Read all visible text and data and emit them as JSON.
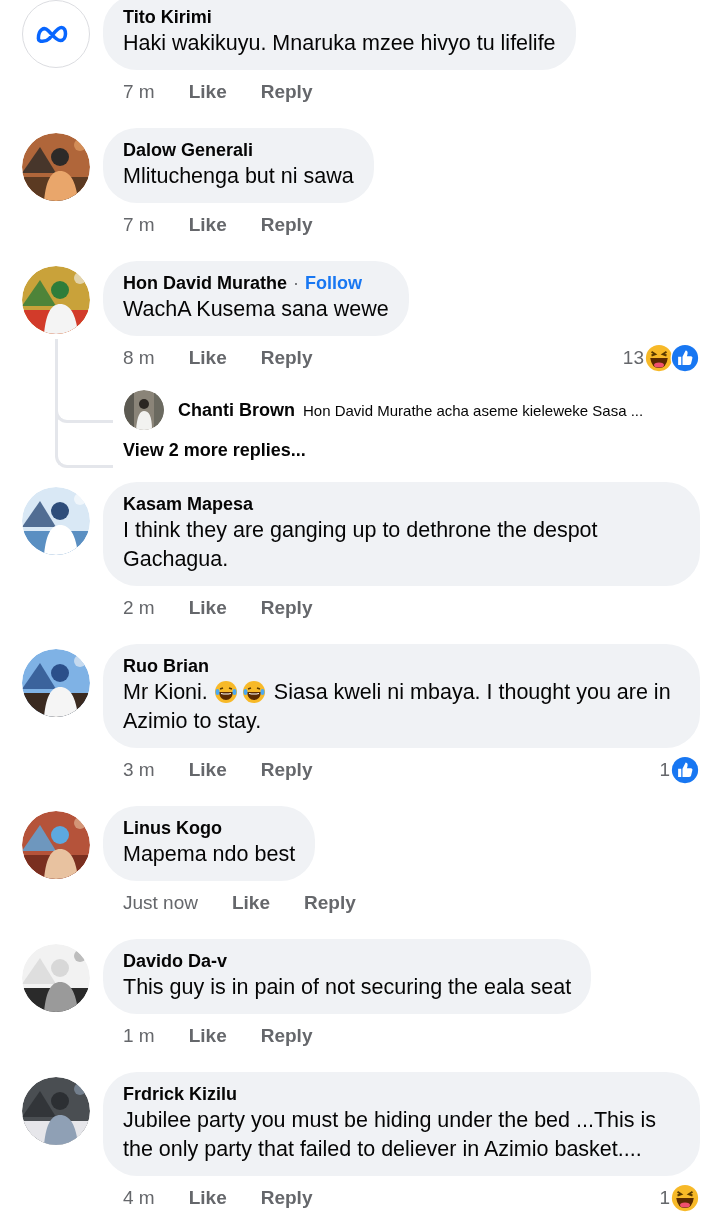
{
  "comments": [
    {
      "author": "Tito Kirimi",
      "avatar": {
        "kind": "logo"
      },
      "body": [
        {
          "kind": "text",
          "text": "Haki wakikuyu. Mnaruka mzee hivyo tu lifelife"
        }
      ],
      "time": "7 m",
      "like": "Like",
      "reply": "Reply"
    },
    {
      "author": "Dalow Generali",
      "avatar": {
        "kind": "picture"
      },
      "body": [
        {
          "kind": "text",
          "text": "Mlituchenga but ni sawa"
        }
      ],
      "time": "7 m",
      "like": "Like",
      "reply": "Reply"
    },
    {
      "author": "Hon David Murathe",
      "separator": "·",
      "follow": "Follow",
      "avatar": {
        "kind": "picture"
      },
      "body": [
        {
          "kind": "text",
          "text": "WachA Kusema sana wewe"
        }
      ],
      "time": "8 m",
      "like": "Like",
      "reply": "Reply",
      "reactions": {
        "count": "13",
        "types": [
          {
            "kind": "haha"
          },
          {
            "kind": "like"
          }
        ]
      },
      "replies": [
        {
          "author": "Chanti Brown",
          "text": "Hon David Murathe acha aseme kieleweke Sasa ..."
        }
      ],
      "more_replies": "View 2 more replies..."
    },
    {
      "author": "Kasam Mapesa",
      "avatar": {
        "kind": "picture"
      },
      "body": [
        {
          "kind": "text",
          "text": "I think they are ganging up to dethrone the despot Gachagua."
        }
      ],
      "time": "2 m",
      "like": "Like",
      "reply": "Reply"
    },
    {
      "author": "Ruo Brian",
      "avatar": {
        "kind": "picture"
      },
      "body": [
        {
          "kind": "text",
          "text": "Mr Kioni."
        },
        {
          "kind": "emoji"
        },
        {
          "kind": "emoji"
        },
        {
          "kind": "text",
          "text": "Siasa kweli ni mbaya. I thought you are in Azimio to stay."
        }
      ],
      "time": "3 m",
      "like": "Like",
      "reply": "Reply",
      "reactions": {
        "count": "1",
        "types": [
          {
            "kind": "like"
          }
        ]
      }
    },
    {
      "author": "Linus Kogo",
      "avatar": {
        "kind": "picture"
      },
      "body": [
        {
          "kind": "text",
          "text": "Mapema ndo best"
        }
      ],
      "time": "Just now",
      "like": "Like",
      "reply": "Reply"
    },
    {
      "author": "Davido Da-v",
      "avatar": {
        "kind": "picture"
      },
      "body": [
        {
          "kind": "text",
          "text": "This guy is in pain of not securing the eala seat"
        }
      ],
      "time": "1 m",
      "like": "Like",
      "reply": "Reply"
    },
    {
      "author": "Frdrick Kizilu",
      "avatar": {
        "kind": "picture"
      },
      "body": [
        {
          "kind": "text",
          "text": "Jubilee party you must be hiding under the bed ...This is the only party that failed to deliever in Azimio basket...."
        }
      ],
      "time": "4 m",
      "like": "Like",
      "reply": "Reply",
      "reactions": {
        "count": "1",
        "types": [
          {
            "kind": "haha"
          }
        ]
      }
    }
  ]
}
